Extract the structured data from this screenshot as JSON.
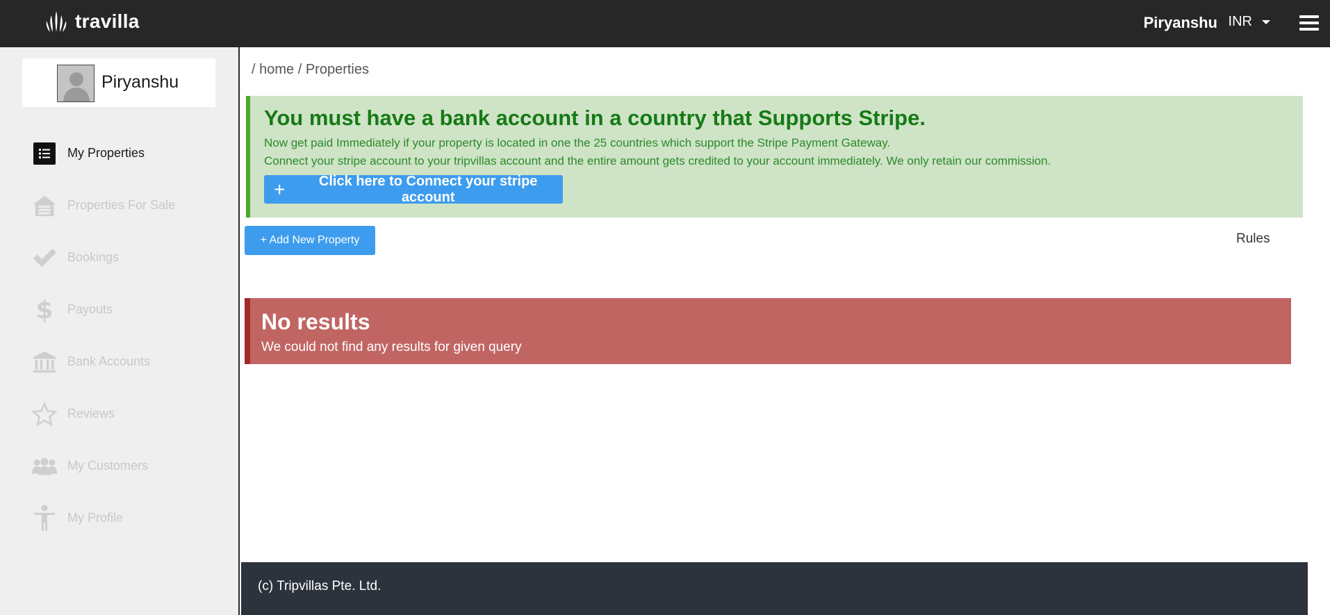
{
  "app": {
    "name": "travilla"
  },
  "header": {
    "user_name": "Piryanshu",
    "currency": "INR"
  },
  "sidebar": {
    "profile_name": "Piryanshu",
    "items": [
      {
        "label": "My Properties",
        "icon": "list-icon",
        "active": true
      },
      {
        "label": "Properties For Sale",
        "icon": "house-icon",
        "active": false
      },
      {
        "label": "Bookings",
        "icon": "checkmark-icon",
        "active": false
      },
      {
        "label": "Payouts",
        "icon": "dollar-icon",
        "active": false
      },
      {
        "label": "Bank Accounts",
        "icon": "bank-icon",
        "active": false
      },
      {
        "label": "Reviews",
        "icon": "star-icon",
        "active": false
      },
      {
        "label": "My Customers",
        "icon": "users-icon",
        "active": false
      },
      {
        "label": "My Profile",
        "icon": "person-icon",
        "active": false
      }
    ]
  },
  "breadcrumb": {
    "separator": "/",
    "home": "home",
    "current": "Properties"
  },
  "stripe_alert": {
    "title": "You must have a bank account in a country that Supports Stripe.",
    "line1": "Now get paid Immediately if your property is located in one the 25 countries which support the Stripe Payment Gateway.",
    "line2": "Connect your stripe account to your tripvillas account and the entire amount gets credited to your account immediately. We only retain our commission.",
    "button_label": "Click here to Connect your stripe account"
  },
  "actions": {
    "add_property_label": "+ Add New Property",
    "rules_label": "Rules"
  },
  "no_results": {
    "title": "No results",
    "subtitle": "We could not find any results for given query"
  },
  "footer": {
    "text": "(c) Tripvillas Pte. Ltd."
  },
  "colors": {
    "topbar": "#272727",
    "sidebar_bg": "#efefef",
    "primary_button": "#3d9ced",
    "success_bg": "#cfe3c6",
    "success_text": "#167a16",
    "danger_bg": "#c16563",
    "footer_bg": "#2c333d"
  }
}
